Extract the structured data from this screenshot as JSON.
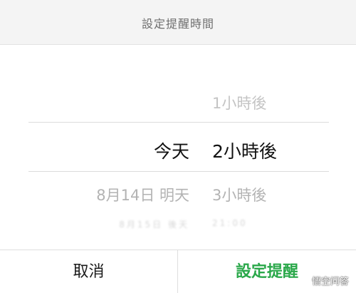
{
  "dialog": {
    "title": "設定提醒時間"
  },
  "picker": {
    "rows": [
      {
        "day": "",
        "time": "1小時後"
      },
      {
        "day": "今天",
        "time": "2小時後"
      },
      {
        "day": "8月14日 明天",
        "time": "3小時後"
      },
      {
        "day": "8月15日 後天",
        "time": "21:00"
      }
    ],
    "selected_index": 1
  },
  "footer": {
    "cancel_label": "取消",
    "confirm_label": "設定提醒"
  },
  "watermark": {
    "text": "悟空问答",
    "icon": "wukong-logo-icon"
  },
  "colors": {
    "confirm": "#2aa84a",
    "header_bg": "#f4f4f4",
    "selected_text": "#111111",
    "faint_text": "#c4c4c4"
  }
}
